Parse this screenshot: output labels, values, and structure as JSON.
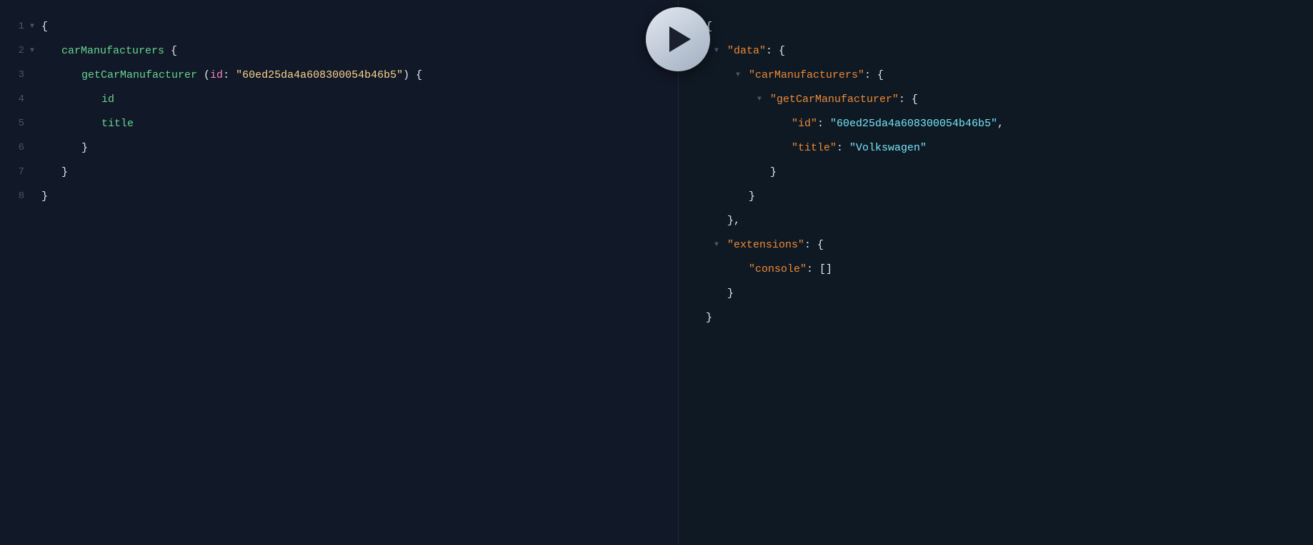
{
  "editor": {
    "lines": [
      {
        "number": "1",
        "hasArrow": true,
        "arrowDir": "down",
        "indent": 0,
        "tokens": [
          {
            "text": "{",
            "color": "white"
          }
        ]
      },
      {
        "number": "2",
        "hasArrow": true,
        "arrowDir": "down",
        "indent": 1,
        "tokens": [
          {
            "text": "carManufacturers",
            "color": "green"
          },
          {
            "text": " {",
            "color": "white"
          }
        ]
      },
      {
        "number": "3",
        "hasArrow": false,
        "indent": 2,
        "tokens": [
          {
            "text": "getCarManufacturer",
            "color": "green"
          },
          {
            "text": " (",
            "color": "white"
          },
          {
            "text": "id",
            "color": "pink"
          },
          {
            "text": ": ",
            "color": "white"
          },
          {
            "text": "\"60ed25da4a608300054b46b5\"",
            "color": "yellow"
          },
          {
            "text": ") {",
            "color": "white"
          }
        ]
      },
      {
        "number": "4",
        "hasArrow": false,
        "indent": 3,
        "tokens": [
          {
            "text": "id",
            "color": "green"
          }
        ]
      },
      {
        "number": "5",
        "hasArrow": false,
        "indent": 3,
        "tokens": [
          {
            "text": "title",
            "color": "green"
          }
        ]
      },
      {
        "number": "6",
        "hasArrow": false,
        "indent": 2,
        "tokens": [
          {
            "text": "}",
            "color": "white"
          }
        ]
      },
      {
        "number": "7",
        "hasArrow": false,
        "indent": 1,
        "tokens": [
          {
            "text": "}",
            "color": "white"
          }
        ]
      },
      {
        "number": "8",
        "hasArrow": false,
        "indent": 0,
        "tokens": [
          {
            "text": "}",
            "color": "white"
          }
        ]
      }
    ]
  },
  "result": {
    "lines": [
      {
        "hasArrow": true,
        "arrowDir": "down",
        "indent": 0,
        "tokens": [
          {
            "text": "{",
            "color": "white"
          }
        ]
      },
      {
        "hasArrow": true,
        "arrowDir": "down",
        "indent": 1,
        "tokens": [
          {
            "text": "\"data\"",
            "color": "orange"
          },
          {
            "text": ": {",
            "color": "white"
          }
        ]
      },
      {
        "hasArrow": true,
        "arrowDir": "down",
        "indent": 2,
        "tokens": [
          {
            "text": "\"carManufacturers\"",
            "color": "orange"
          },
          {
            "text": ": {",
            "color": "white"
          }
        ]
      },
      {
        "hasArrow": true,
        "arrowDir": "down",
        "indent": 3,
        "tokens": [
          {
            "text": "\"getCarManufacturer\"",
            "color": "orange"
          },
          {
            "text": ": {",
            "color": "white"
          }
        ]
      },
      {
        "hasArrow": false,
        "indent": 4,
        "tokens": [
          {
            "text": "\"id\"",
            "color": "orange"
          },
          {
            "text": ": ",
            "color": "white"
          },
          {
            "text": "\"60ed25da4a608300054b46b5\"",
            "color": "cyan"
          },
          {
            "text": ",",
            "color": "white"
          }
        ]
      },
      {
        "hasArrow": false,
        "indent": 4,
        "tokens": [
          {
            "text": "\"title\"",
            "color": "orange"
          },
          {
            "text": ": ",
            "color": "white"
          },
          {
            "text": "\"Volkswagen\"",
            "color": "cyan"
          }
        ]
      },
      {
        "hasArrow": false,
        "indent": 3,
        "tokens": [
          {
            "text": "}",
            "color": "white"
          }
        ]
      },
      {
        "hasArrow": false,
        "indent": 2,
        "tokens": [
          {
            "text": "}",
            "color": "white"
          }
        ]
      },
      {
        "hasArrow": false,
        "indent": 1,
        "tokens": [
          {
            "text": "},",
            "color": "white"
          }
        ]
      },
      {
        "hasArrow": true,
        "arrowDir": "down",
        "indent": 1,
        "tokens": [
          {
            "text": "\"extensions\"",
            "color": "orange"
          },
          {
            "text": ": {",
            "color": "white"
          }
        ]
      },
      {
        "hasArrow": false,
        "indent": 2,
        "tokens": [
          {
            "text": "\"console\"",
            "color": "orange"
          },
          {
            "text": ": []",
            "color": "white"
          }
        ]
      },
      {
        "hasArrow": false,
        "indent": 1,
        "tokens": [
          {
            "text": "}",
            "color": "white"
          }
        ]
      },
      {
        "hasArrow": false,
        "indent": 0,
        "tokens": [
          {
            "text": "}",
            "color": "white"
          }
        ]
      }
    ]
  },
  "playButton": {
    "label": "Run Query"
  },
  "colors": {
    "background_editor": "#111827",
    "background_result": "#0f1923",
    "white": "#e2e8f0",
    "green": "#68d391",
    "pink": "#f687b3",
    "orange": "#ed8936",
    "blue": "#63b3ed",
    "yellow": "#fbd38d",
    "cyan": "#76e4f7"
  }
}
